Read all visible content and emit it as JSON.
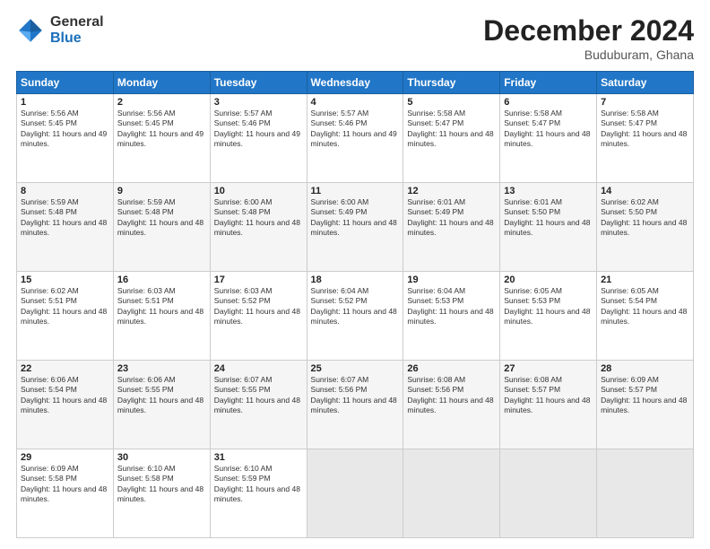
{
  "logo": {
    "general": "General",
    "blue": "Blue"
  },
  "header": {
    "month": "December 2024",
    "location": "Buduburam, Ghana"
  },
  "days_of_week": [
    "Sunday",
    "Monday",
    "Tuesday",
    "Wednesday",
    "Thursday",
    "Friday",
    "Saturday"
  ],
  "weeks": [
    [
      {
        "day": "1",
        "sunrise": "5:56 AM",
        "sunset": "5:45 PM",
        "daylight": "11 hours and 49 minutes."
      },
      {
        "day": "2",
        "sunrise": "5:56 AM",
        "sunset": "5:45 PM",
        "daylight": "11 hours and 49 minutes."
      },
      {
        "day": "3",
        "sunrise": "5:57 AM",
        "sunset": "5:46 PM",
        "daylight": "11 hours and 49 minutes."
      },
      {
        "day": "4",
        "sunrise": "5:57 AM",
        "sunset": "5:46 PM",
        "daylight": "11 hours and 49 minutes."
      },
      {
        "day": "5",
        "sunrise": "5:58 AM",
        "sunset": "5:47 PM",
        "daylight": "11 hours and 48 minutes."
      },
      {
        "day": "6",
        "sunrise": "5:58 AM",
        "sunset": "5:47 PM",
        "daylight": "11 hours and 48 minutes."
      },
      {
        "day": "7",
        "sunrise": "5:58 AM",
        "sunset": "5:47 PM",
        "daylight": "11 hours and 48 minutes."
      }
    ],
    [
      {
        "day": "8",
        "sunrise": "5:59 AM",
        "sunset": "5:48 PM",
        "daylight": "11 hours and 48 minutes."
      },
      {
        "day": "9",
        "sunrise": "5:59 AM",
        "sunset": "5:48 PM",
        "daylight": "11 hours and 48 minutes."
      },
      {
        "day": "10",
        "sunrise": "6:00 AM",
        "sunset": "5:48 PM",
        "daylight": "11 hours and 48 minutes."
      },
      {
        "day": "11",
        "sunrise": "6:00 AM",
        "sunset": "5:49 PM",
        "daylight": "11 hours and 48 minutes."
      },
      {
        "day": "12",
        "sunrise": "6:01 AM",
        "sunset": "5:49 PM",
        "daylight": "11 hours and 48 minutes."
      },
      {
        "day": "13",
        "sunrise": "6:01 AM",
        "sunset": "5:50 PM",
        "daylight": "11 hours and 48 minutes."
      },
      {
        "day": "14",
        "sunrise": "6:02 AM",
        "sunset": "5:50 PM",
        "daylight": "11 hours and 48 minutes."
      }
    ],
    [
      {
        "day": "15",
        "sunrise": "6:02 AM",
        "sunset": "5:51 PM",
        "daylight": "11 hours and 48 minutes."
      },
      {
        "day": "16",
        "sunrise": "6:03 AM",
        "sunset": "5:51 PM",
        "daylight": "11 hours and 48 minutes."
      },
      {
        "day": "17",
        "sunrise": "6:03 AM",
        "sunset": "5:52 PM",
        "daylight": "11 hours and 48 minutes."
      },
      {
        "day": "18",
        "sunrise": "6:04 AM",
        "sunset": "5:52 PM",
        "daylight": "11 hours and 48 minutes."
      },
      {
        "day": "19",
        "sunrise": "6:04 AM",
        "sunset": "5:53 PM",
        "daylight": "11 hours and 48 minutes."
      },
      {
        "day": "20",
        "sunrise": "6:05 AM",
        "sunset": "5:53 PM",
        "daylight": "11 hours and 48 minutes."
      },
      {
        "day": "21",
        "sunrise": "6:05 AM",
        "sunset": "5:54 PM",
        "daylight": "11 hours and 48 minutes."
      }
    ],
    [
      {
        "day": "22",
        "sunrise": "6:06 AM",
        "sunset": "5:54 PM",
        "daylight": "11 hours and 48 minutes."
      },
      {
        "day": "23",
        "sunrise": "6:06 AM",
        "sunset": "5:55 PM",
        "daylight": "11 hours and 48 minutes."
      },
      {
        "day": "24",
        "sunrise": "6:07 AM",
        "sunset": "5:55 PM",
        "daylight": "11 hours and 48 minutes."
      },
      {
        "day": "25",
        "sunrise": "6:07 AM",
        "sunset": "5:56 PM",
        "daylight": "11 hours and 48 minutes."
      },
      {
        "day": "26",
        "sunrise": "6:08 AM",
        "sunset": "5:56 PM",
        "daylight": "11 hours and 48 minutes."
      },
      {
        "day": "27",
        "sunrise": "6:08 AM",
        "sunset": "5:57 PM",
        "daylight": "11 hours and 48 minutes."
      },
      {
        "day": "28",
        "sunrise": "6:09 AM",
        "sunset": "5:57 PM",
        "daylight": "11 hours and 48 minutes."
      }
    ],
    [
      {
        "day": "29",
        "sunrise": "6:09 AM",
        "sunset": "5:58 PM",
        "daylight": "11 hours and 48 minutes."
      },
      {
        "day": "30",
        "sunrise": "6:10 AM",
        "sunset": "5:58 PM",
        "daylight": "11 hours and 48 minutes."
      },
      {
        "day": "31",
        "sunrise": "6:10 AM",
        "sunset": "5:59 PM",
        "daylight": "11 hours and 48 minutes."
      },
      null,
      null,
      null,
      null
    ]
  ],
  "labels": {
    "sunrise_prefix": "Sunrise: ",
    "sunset_prefix": "Sunset: ",
    "daylight_prefix": "Daylight: "
  }
}
